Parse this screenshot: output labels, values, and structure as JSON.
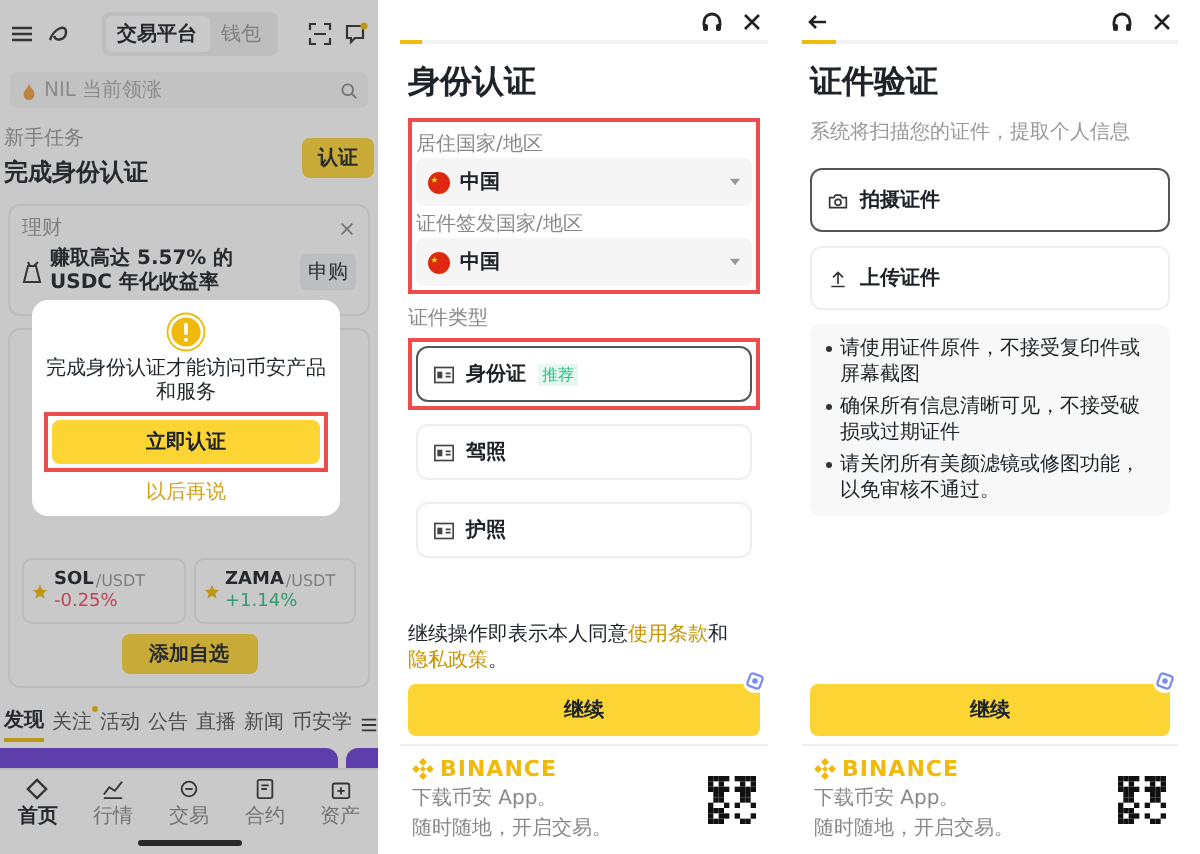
{
  "left_screen": {
    "top_tabs": [
      {
        "label": "交易平台",
        "selected": true
      },
      {
        "label": "钱包",
        "selected": false
      }
    ],
    "search": {
      "placeholder": "NIL 当前领涨"
    },
    "task": {
      "label": "新手任务",
      "title": "完成身份认证",
      "button": "认证"
    },
    "promo": {
      "label": "理财",
      "text": "赚取高达 5.57% 的 USDC 年化收益率",
      "button": "申购"
    },
    "watchlist": [
      {
        "symbol": "SOL",
        "quote": "/USDT",
        "change": "-0.25%",
        "color": "#c24354"
      },
      {
        "symbol": "ZAMA",
        "quote": "/USDT",
        "change": "+1.14%",
        "color": "#329971"
      }
    ],
    "add_button": "添加自选",
    "feed_tabs": [
      {
        "label": "发现",
        "selected": true,
        "dot": false
      },
      {
        "label": "关注",
        "selected": false,
        "dot": true
      },
      {
        "label": "活动",
        "selected": false,
        "dot": false
      },
      {
        "label": "公告",
        "selected": false,
        "dot": false
      },
      {
        "label": "直播",
        "selected": false,
        "dot": false
      },
      {
        "label": "新闻",
        "selected": false,
        "dot": false
      },
      {
        "label": "币安学",
        "selected": false,
        "dot": false
      }
    ],
    "nav": [
      {
        "label": "首页",
        "selected": true
      },
      {
        "label": "行情",
        "selected": false
      },
      {
        "label": "交易",
        "selected": false
      },
      {
        "label": "合约",
        "selected": false
      },
      {
        "label": "资产",
        "selected": false
      }
    ],
    "dialog": {
      "message": "完成身份认证才能访问币安产品和服务",
      "primary": "立即认证",
      "secondary": "以后再说",
      "highlighted": true
    }
  },
  "middle_screen": {
    "progress": {
      "level": 0.06
    },
    "title": "身份认证",
    "fields": [
      {
        "label": "居住国家/地区",
        "value": "中国"
      },
      {
        "label": "证件签发国家/地区",
        "value": "中国"
      }
    ],
    "fields_highlighted": true,
    "doc_type_label": "证件类型",
    "doc_types": [
      {
        "label": "身份证",
        "badge": "推荐",
        "selected": true,
        "highlighted": true
      },
      {
        "label": "驾照",
        "selected": false,
        "highlighted": false
      },
      {
        "label": "护照",
        "selected": false,
        "highlighted": false
      }
    ],
    "consent": [
      {
        "kind": "text",
        "text": "继续操作即表示本人同意"
      },
      {
        "kind": "link",
        "text": "使用条款"
      },
      {
        "kind": "text",
        "text": "和"
      },
      {
        "kind": "link",
        "text": "隐私政策"
      },
      {
        "kind": "text",
        "text": "。"
      }
    ],
    "button": "继续",
    "footer": {
      "brand": "BINANCE",
      "lines": [
        "下载币安 App。",
        "随时随地，开启交易。"
      ]
    }
  },
  "right_screen": {
    "progress": {
      "level": 0.09
    },
    "title": "证件验证",
    "subtitle": "系统将扫描您的证件，提取个人信息",
    "options": [
      {
        "label": "拍摄证件",
        "selected": true
      },
      {
        "label": "上传证件",
        "selected": false
      }
    ],
    "notes": [
      "请使用证件原件，不接受复印件或屏幕截图",
      "确保所有信息清晰可见，不接受破损或过期证件",
      "请关闭所有美颜滤镜或修图功能，以免审核不通过。"
    ],
    "button": "继续",
    "footer": {
      "brand": "BINANCE",
      "lines": [
        "下载币安 App。",
        "随时随地，开启交易。"
      ]
    }
  }
}
